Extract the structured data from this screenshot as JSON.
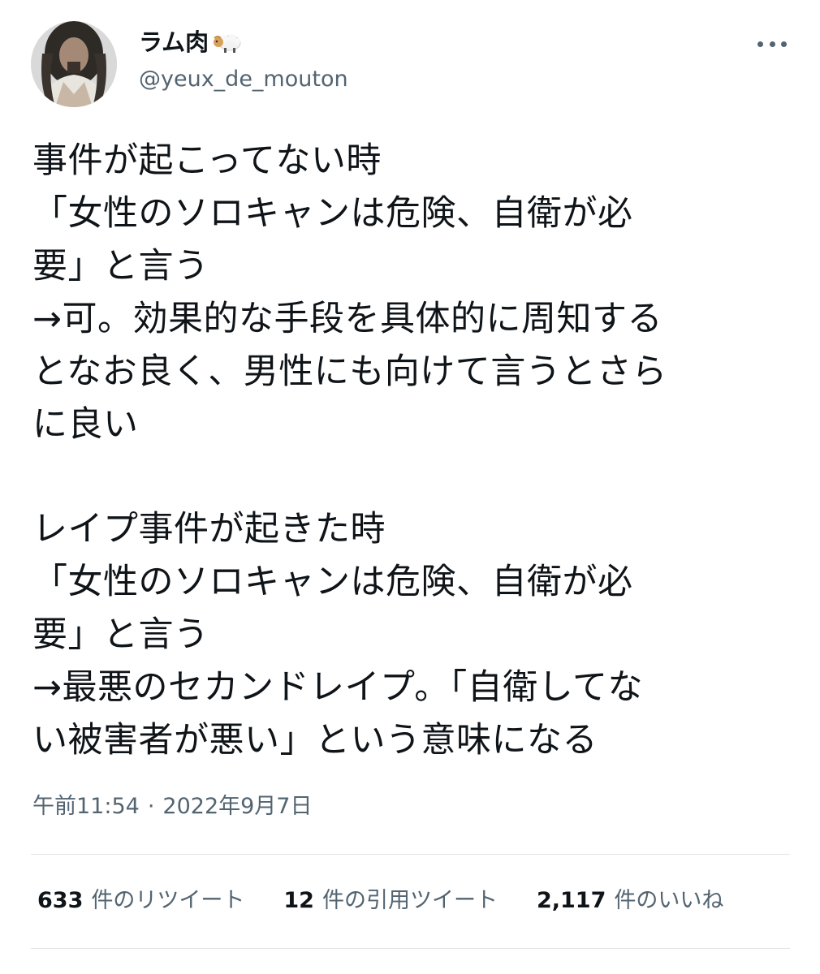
{
  "author": {
    "display_name": "ラム肉",
    "name_emoji": "sheep-emoji",
    "handle": "@yeux_de_mouton"
  },
  "tweet": {
    "lines": [
      "事件が起こってない時",
      "「女性のソロキャンは危険、自衛が必",
      "要」と言う",
      "→可。効果的な手段を具体的に周知する",
      "となお良く、男性にも向けて言うとさら",
      "に良い",
      "",
      "レイプ事件が起きた時",
      "「女性のソロキャンは危険、自衛が必",
      "要」と言う",
      "→最悪のセカンドレイプ。「自衛してな",
      "い被害者が悪い」という意味になる"
    ]
  },
  "meta": {
    "time": "午前11:54",
    "separator": "·",
    "date": "2022年9月7日"
  },
  "stats": {
    "retweets": {
      "count": "633",
      "label": "件のリツイート"
    },
    "quotes": {
      "count": "12",
      "label": "件の引用ツイート"
    },
    "likes": {
      "count": "2,117",
      "label": "件のいいね"
    }
  },
  "colors": {
    "text": "#0f1419",
    "secondary": "#536471",
    "divider": "#e1e5e8"
  }
}
